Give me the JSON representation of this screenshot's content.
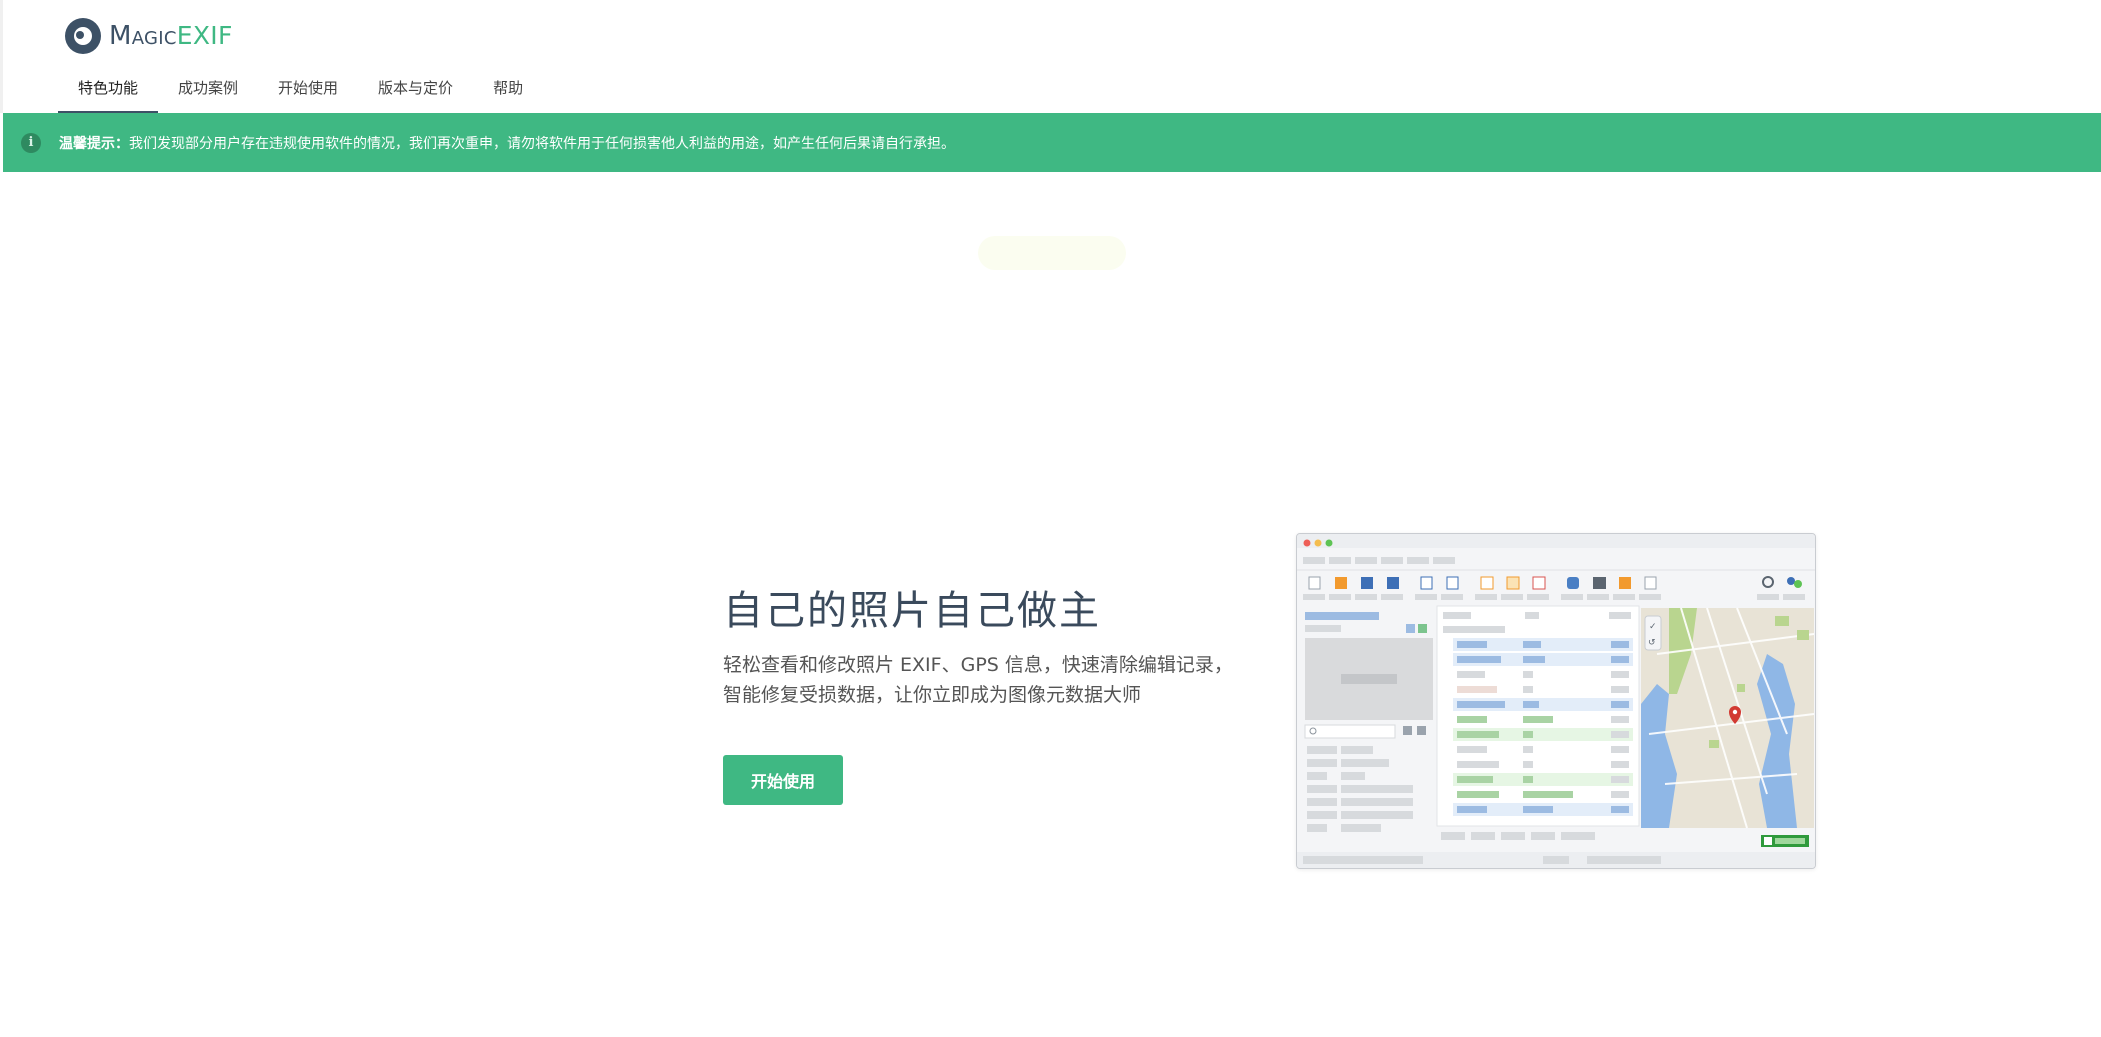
{
  "brand": {
    "name_magic": "Magic",
    "name_exif": "EXIF",
    "accent": "#3fb883",
    "dark": "#3d5166"
  },
  "nav": {
    "items": [
      {
        "label": "特色功能",
        "active": true
      },
      {
        "label": "成功案例",
        "active": false
      },
      {
        "label": "开始使用",
        "active": false
      },
      {
        "label": "版本与定价",
        "active": false
      },
      {
        "label": "帮助",
        "active": false
      }
    ]
  },
  "notice": {
    "icon": "info-icon",
    "prefix": "温馨提示：",
    "text": "我们发现部分用户存在违规使用软件的情况，我们再次重申，请勿将软件用于任何损害他人利益的用途，如产生任何后果请自行承担。"
  },
  "hero": {
    "title": "自己的照片自己做主",
    "subtitle_line1": "轻松查看和修改照片 EXIF、GPS 信息，快速清除编辑记录，",
    "subtitle_line2": "智能修复受损数据，让你立即成为图像元数据大师",
    "cta_label": "开始使用"
  },
  "preview": {
    "description_icon": "app-screenshot-illustration",
    "map_pin_color": "#d23a32"
  }
}
